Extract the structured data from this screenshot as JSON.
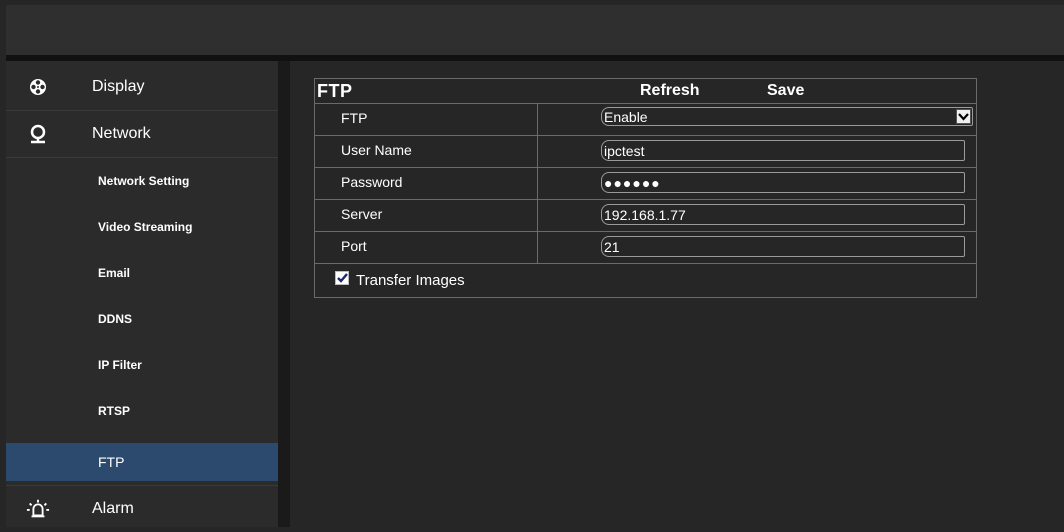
{
  "sidebar": {
    "display": {
      "label": "Display",
      "icon": "film-reel-icon"
    },
    "network": {
      "label": "Network",
      "icon": "location-pin-icon"
    },
    "sub_items": [
      {
        "label": "Network Setting"
      },
      {
        "label": "Video Streaming"
      },
      {
        "label": "Email"
      },
      {
        "label": "DDNS"
      },
      {
        "label": "IP Filter"
      },
      {
        "label": "RTSP"
      },
      {
        "label": "FTP",
        "active": true
      }
    ],
    "alarm": {
      "label": "Alarm",
      "icon": "alarm-light-icon"
    }
  },
  "panel": {
    "title": "FTP",
    "refresh_label": "Refresh",
    "save_label": "Save",
    "rows": [
      {
        "label": "FTP",
        "type": "select",
        "value": "Enable"
      },
      {
        "label": "User Name",
        "type": "text",
        "value": "ipctest"
      },
      {
        "label": "Password",
        "type": "password",
        "value": "●●●●●●"
      },
      {
        "label": "Server",
        "type": "text",
        "value": "192.168.1.77"
      },
      {
        "label": "Port",
        "type": "text",
        "value": "21"
      }
    ],
    "transfer_images": {
      "label": "Transfer Images",
      "checked": true
    }
  },
  "colors": {
    "background": "#262626",
    "sidebar": "#2b2b2b",
    "active_item": "#2b4a6e",
    "border": "#6a6a6a"
  }
}
